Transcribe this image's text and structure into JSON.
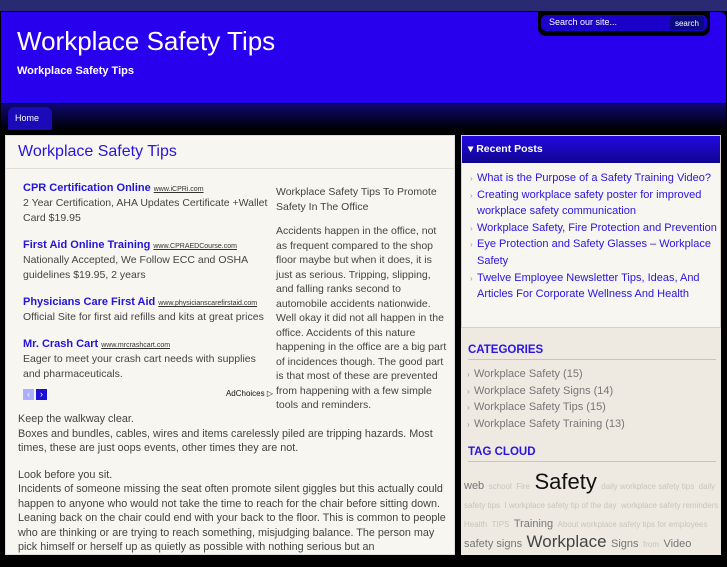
{
  "header": {
    "title": "Workplace Safety Tips",
    "description": "Workplace Safety Tips",
    "search_placeholder": "Search our site...",
    "search_button": "search"
  },
  "nav": {
    "items": [
      "Home"
    ]
  },
  "main": {
    "title": "Workplace Safety Tips",
    "ads": [
      {
        "title": "CPR Certification Online",
        "url": "www.iCPRi.com",
        "desc": "2 Year Certification, AHA Updates Certificate +Wallet Card $19.95"
      },
      {
        "title": "First Aid Online Training",
        "url": "www.CPRAEDCourse.com",
        "desc": "Nationally Accepted, We Follow ECC and OSHA guidelines $19.95, 2 years"
      },
      {
        "title": "Physicians Care First Aid",
        "url": "www.physicianscarefirstaid.com",
        "desc": "Official Site for first aid refills and kits at great prices"
      },
      {
        "title": "Mr. Crash Cart",
        "url": "www.mrcrashcart.com",
        "desc": "Eager to meet your crash cart needs with supplies and pharmaceuticals."
      }
    ],
    "ad_prev": "‹",
    "ad_next": "›",
    "adchoices": "AdChoices ▷",
    "intro": [
      "Workplace Safety Tips To Promote Safety In The Office",
      "Accidents happen in the office, not as frequent compared to the shop floor maybe but when it does, it is just as serious. Tripping, slipping, and falling ranks second to automobile accidents nationwide. Well okay it did not all happen in the office. Accidents of this nature happening in the office are a big part of incidences though. The good part is that most of these are prevented from happening with a few simple tools and reminders."
    ],
    "paragraphs": [
      {
        "heading": "Keep the walkway clear.",
        "text": "Boxes and bundles, cables, wires and items carelessly piled are tripping hazards. Most times, these are just oops events, other times they are not."
      },
      {
        "heading": "Look before you sit.",
        "text": "Incidents of someone missing the seat often promote silent giggles but this actually could happen to anyone who would not take the time to reach for the chair before sitting down. Leaning back on the chair could end with your back to the floor. This is common to people who are thinking or are trying to reach something, misjudging balance. The person may pick himself or herself up as quietly as possible with nothing serious but an"
      }
    ]
  },
  "sidebar": {
    "recent_title": "Recent Posts",
    "recent_posts": [
      "What is the Purpose of a Safety Training Video?",
      "Creating workplace safety poster for improved workplace safety communication",
      "Workplace Safety, Fire Protection and Prevention",
      "Eye Protection and Safety Glasses – Workplace Safety",
      "Twelve Employee Newsletter Tips, Ideas, And Articles For Corporate Wellness And Health"
    ],
    "categories_title": "CATEGORIES",
    "categories": [
      "Workplace Safety (15)",
      "Workplace Safety Signs (14)",
      "Workplace Safety Tips (15)",
      "Workplace Safety Training (13)"
    ],
    "tagcloud_title": "TAG CLOUD",
    "tags": [
      {
        "t": "web",
        "w": "m"
      },
      {
        "t": "school",
        "w": "s"
      },
      {
        "t": "Fire",
        "w": "s"
      },
      {
        "t": "Safety",
        "w": "xl"
      },
      {
        "t": "daily workplace safety tips",
        "w": "s"
      },
      {
        "t": "daily safety tips",
        "w": "s"
      },
      {
        "t": "I workplace safety tip of the day",
        "w": "s"
      },
      {
        "t": "workplace safety reminders",
        "w": "s"
      },
      {
        "t": "Health",
        "w": "s"
      },
      {
        "t": "TIPS",
        "w": "s"
      },
      {
        "t": "Training",
        "w": "m"
      },
      {
        "t": "About workplace safety tips for employees",
        "w": "s"
      },
      {
        "t": "safety signs",
        "w": "m"
      },
      {
        "t": "Workplace",
        "w": "l"
      },
      {
        "t": "Signs",
        "w": "m"
      },
      {
        "t": "from",
        "w": "s"
      },
      {
        "t": "Video",
        "w": "m"
      }
    ]
  },
  "colors": {
    "header": "#2800ee",
    "accent": "#2a14e0"
  }
}
